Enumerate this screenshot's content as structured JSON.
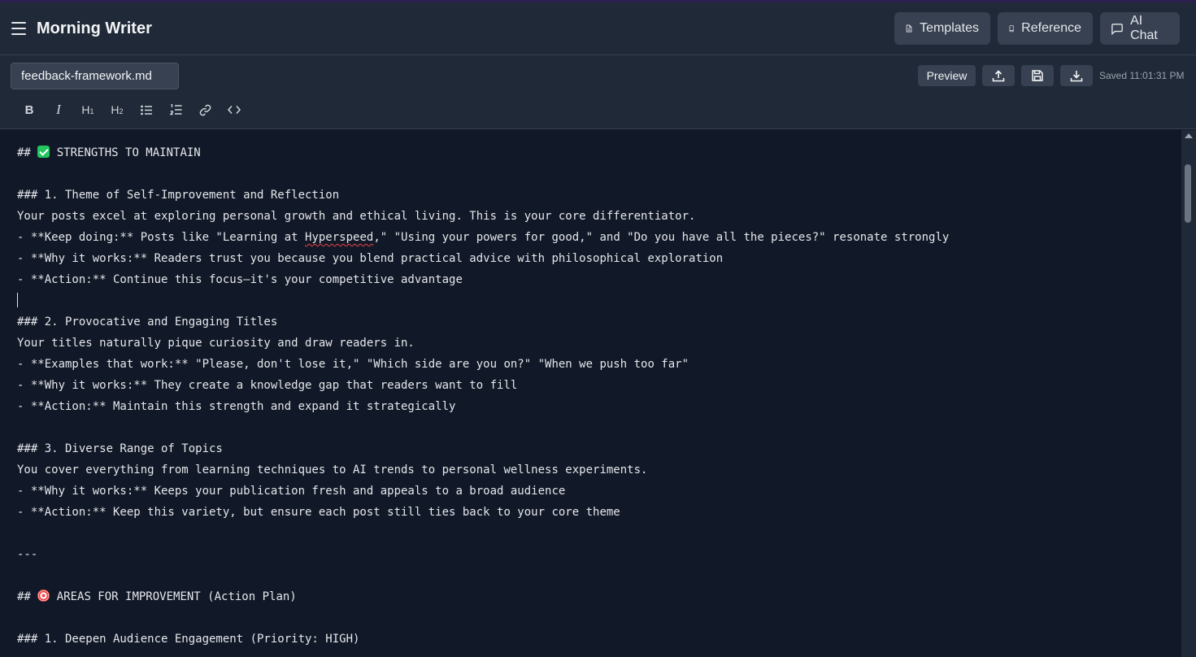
{
  "app": {
    "title": "Morning Writer"
  },
  "header": {
    "templates_label": "Templates",
    "reference_label": "Reference",
    "ai_chat_label": "AI Chat"
  },
  "file": {
    "name": "feedback-framework.md",
    "preview_label": "Preview",
    "saved_status": "Saved 11:01:31 PM"
  },
  "toolbar": {
    "bold": "B",
    "italic": "I",
    "h1": "H",
    "h1_sub": "1",
    "h2": "H",
    "h2_sub": "2",
    "icons": [
      "bullet-list-icon",
      "numbered-list-icon",
      "link-icon",
      "code-icon"
    ]
  },
  "editor": {
    "lines": [
      {
        "pre": "## ",
        "emoji": "check",
        "post": " STRENGTHS TO MAINTAIN"
      },
      {
        "text": ""
      },
      {
        "text": "### 1. Theme of Self-Improvement and Reflection"
      },
      {
        "text": "Your posts excel at exploring personal growth and ethical living. This is your core differentiator."
      },
      {
        "pre": "- **Keep doing:** Posts like \"Learning at ",
        "squiggle": "Hyperspeed",
        "post": ",\" \"Using your powers for good,\" and \"Do you have all the pieces?\" resonate strongly"
      },
      {
        "text": "- **Why it works:** Readers trust you because you blend practical advice with philosophical exploration"
      },
      {
        "text": "- **Action:** Continue this focus—it's your competitive advantage"
      },
      {
        "caret": true
      },
      {
        "text": "### 2. Provocative and Engaging Titles"
      },
      {
        "text": "Your titles naturally pique curiosity and draw readers in."
      },
      {
        "text": "- **Examples that work:** \"Please, don't lose it,\" \"Which side are you on?\" \"When we push too far\""
      },
      {
        "text": "- **Why it works:** They create a knowledge gap that readers want to fill"
      },
      {
        "text": "- **Action:** Maintain this strength and expand it strategically"
      },
      {
        "text": ""
      },
      {
        "text": "### 3. Diverse Range of Topics"
      },
      {
        "text": "You cover everything from learning techniques to AI trends to personal wellness experiments."
      },
      {
        "text": "- **Why it works:** Keeps your publication fresh and appeals to a broad audience"
      },
      {
        "text": "- **Action:** Keep this variety, but ensure each post still ties back to your core theme"
      },
      {
        "text": ""
      },
      {
        "text": "---"
      },
      {
        "text": ""
      },
      {
        "pre": "## ",
        "emoji": "target",
        "post": " AREAS FOR IMPROVEMENT (Action Plan)"
      },
      {
        "text": ""
      },
      {
        "text": "### 1. Deepen Audience Engagement (Priority: HIGH)"
      }
    ]
  },
  "colors": {
    "background": "#111827",
    "panel": "#1f2937",
    "button": "#374151",
    "text": "#e5e7eb",
    "spellcheck": "#ef4444"
  }
}
